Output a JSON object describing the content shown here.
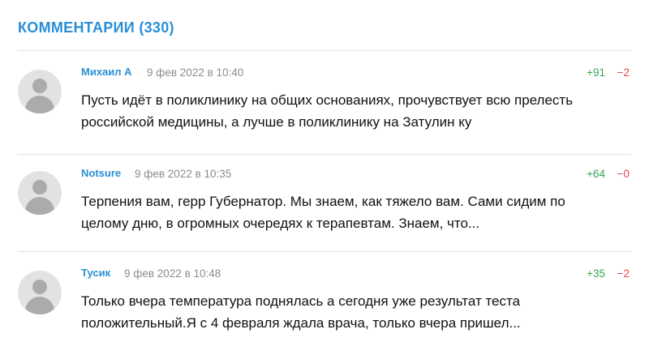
{
  "comments_section": {
    "title": "КОММЕНТАРИИ (330)"
  },
  "comments": [
    {
      "author": "Михаил А",
      "date": "9 фев 2022 в 10:40",
      "votes_up": "+91",
      "votes_down": "−2",
      "text": "Пусть идёт в поликлинику на общих основаниях, прочувствует всю прелесть российской медицины, а лучше в поликлинику на Затулин ку",
      "avatar_icon": "user-silhouette-icon"
    },
    {
      "author": "Notsure",
      "date": "9 фев 2022 в 10:35",
      "votes_up": "+64",
      "votes_down": "−0",
      "text": "Терпения вам, герр Губернатор. Мы знаем, как тяжело вам. Сами сидим по целому дню, в огромных очередях к терапевтам. Знаем, что...",
      "avatar_icon": "user-silhouette-icon"
    },
    {
      "author": "Тусик",
      "date": "9 фев 2022 в 10:48",
      "votes_up": "+35",
      "votes_down": "−2",
      "text": "Только вчера температура поднялась а сегодня уже результат теста положительный.Я с 4 февраля ждала врача, только вчера пришел...",
      "avatar_icon": "user-silhouette-icon"
    }
  ],
  "colors": {
    "accent": "#2a8fd6",
    "vote_up": "#36a852",
    "vote_down": "#e64646",
    "date": "#8c8c8c",
    "avatar_bg": "#e2e2e2",
    "avatar_fg": "#ababab"
  }
}
